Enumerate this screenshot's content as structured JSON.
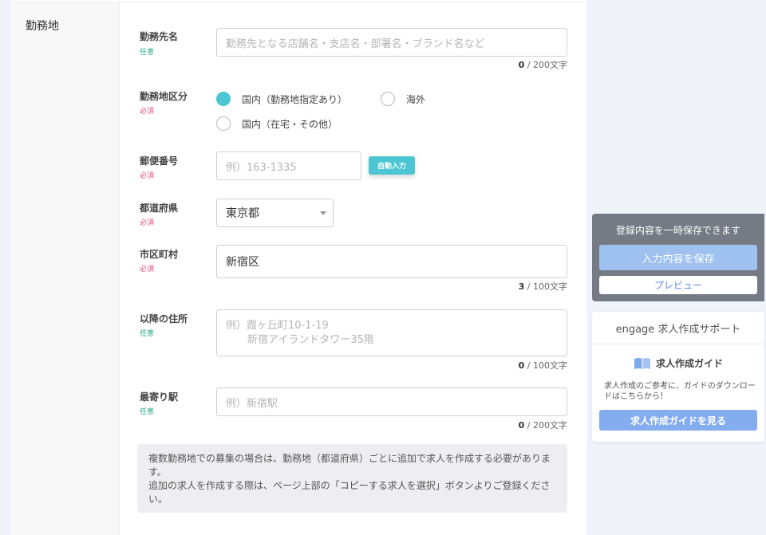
{
  "section": {
    "title": "勤務地"
  },
  "fields": {
    "workplace_name": {
      "label": "勤務先名",
      "tag": "任意",
      "placeholder": "勤務先となる店舗名・支店名・部署名・ブランド名など",
      "count": "0",
      "limit": " / 200文字"
    },
    "workplace_type": {
      "label": "勤務地区分",
      "tag": "必須",
      "options": [
        "国内（勤務地指定あり）",
        "海外",
        "国内（在宅・その他）"
      ],
      "selected": "国内（勤務地指定あり）"
    },
    "postal_code": {
      "label": "郵便番号",
      "tag": "必須",
      "placeholder": "例）163-1335",
      "auto_button": "自動入力"
    },
    "prefecture": {
      "label": "都道府県",
      "tag": "必須",
      "value": "東京都"
    },
    "city": {
      "label": "市区町村",
      "tag": "必須",
      "value": "新宿区",
      "count": "3",
      "limit": " / 100文字"
    },
    "address": {
      "label": "以降の住所",
      "tag": "任意",
      "placeholder_line1": "例）霞ヶ丘町10-1-19",
      "placeholder_line2": "新宿アイランドタワー35階",
      "count": "0",
      "limit": " / 100文字"
    },
    "station": {
      "label": "最寄り駅",
      "tag": "任意",
      "placeholder": "例）新宿駅",
      "count": "0",
      "limit": " / 200文字"
    }
  },
  "note": {
    "line1": "複数勤務地での募集の場合は、勤務地（都道府県）ごとに追加で求人を作成する必要があります。",
    "line2": "追加の求人を作成する際は、ページ上部の「コピーする求人を選択」ボタンよりご登録ください。"
  },
  "save_panel": {
    "title": "登録内容を一時保存できます",
    "save_button": "入力内容を保存",
    "preview_button": "プレビュー"
  },
  "support_panel": {
    "title": "engage 求人作成サポート",
    "guide_title": "求人作成ガイド",
    "description": "求人作成のご参考に、ガイドのダウンロードはこちらから！",
    "guide_button": "求人作成ガイドを見る"
  },
  "colors": {
    "accent": "#4cc6d2",
    "required": "#e5507a",
    "optional": "#1ba885",
    "save_button": "#9ec1ef",
    "guide_button": "#84adf0"
  },
  "icons": {
    "guide": "book-icon",
    "select": "chevron-down-icon"
  }
}
